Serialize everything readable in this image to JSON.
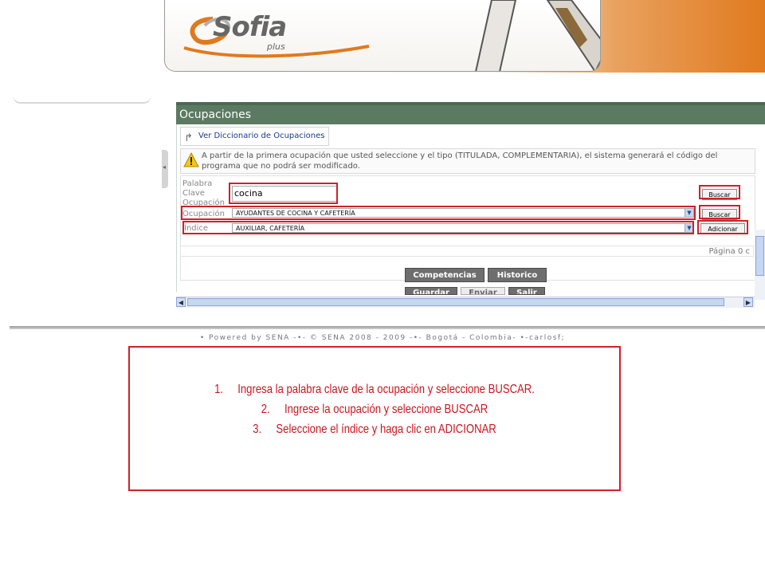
{
  "header": {
    "logo_text": "Sofia",
    "logo_subtext": "plus"
  },
  "panel": {
    "title": "Ocupaciones",
    "dictionary_link": "Ver Diccionario de Ocupaciones",
    "warning_text": "A partir de la primera ocupación que usted seleccione y el tipo (TITULADA, COMPLEMENTARIA), el sistema generará el código del programa que no podrá ser modificado.",
    "keyword_label_lines": [
      "Palabra",
      "Clave",
      "Ocupación"
    ],
    "keyword_value": "cocina",
    "occupation_label": "Ocupación",
    "occupation_value": "AYUDANTES DE COCINA Y CAFETERÍA",
    "index_label": "Índice",
    "index_value": "AUXILIAR, CAFETERÍA",
    "search_button_1": "Buscar",
    "search_button_2": "Buscar",
    "add_button": "Adicionar",
    "pagination_text": "Página 0 c",
    "competencias_button": "Competencias",
    "historico_button": "Historico",
    "guardar_button": "Guardar",
    "enviar_button": "Enviar",
    "salir_button": "Salir"
  },
  "footer": {
    "text": "• Powered by SENA -•- © SENA 2008 - 2009 -•- Bogotá - Colombia- •-carlosf;"
  },
  "instructions": [
    "1.     Ingresa la palabra clave de la ocupación y seleccione BUSCAR.",
    "2.     Ingrese la ocupación y seleccione BUSCAR",
    "3.     Seleccione el índice y haga clic en ADICIONAR"
  ],
  "colors": {
    "highlight_red": "#d0202a",
    "panel_header": "#5b7a62",
    "brand_orange": "#e07a1f"
  },
  "icons": [
    "logo-swoosh-icon",
    "arrow-redo-icon",
    "warning-icon",
    "chevron-down-icon",
    "scroll-left-icon",
    "scroll-right-icon"
  ]
}
